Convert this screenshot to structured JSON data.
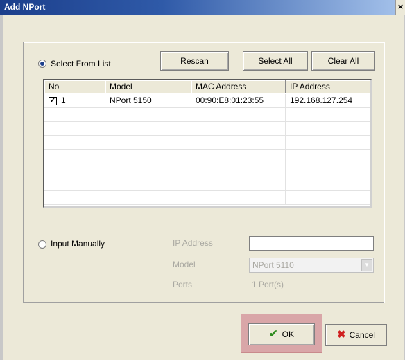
{
  "window": {
    "title": "Add NPort",
    "close_glyph": "×"
  },
  "select_from_list": {
    "label": "Select From List",
    "selected": true,
    "rescan_label": "Rescan",
    "select_all_label": "Select All",
    "clear_all_label": "Clear All"
  },
  "table": {
    "columns": [
      "No",
      "Model",
      "MAC Address",
      "IP Address"
    ],
    "rows": [
      {
        "checked": true,
        "no": "1",
        "model": "NPort 5150",
        "mac": "00:90:E8:01:23:55",
        "ip": "192.168.127.254"
      }
    ],
    "empty_rows": 7
  },
  "input_manually": {
    "label": "Input Manually",
    "selected": false,
    "ip_label": "IP Address",
    "ip_value": "",
    "model_label": "Model",
    "model_value": "NPort 5110",
    "ports_label": "Ports",
    "ports_value": "1 Port(s)"
  },
  "footer": {
    "ok_label": "OK",
    "cancel_label": "Cancel"
  },
  "colors": {
    "titlebar": "#1c3f8c",
    "highlight": "#d9a6a8",
    "ok_icon": "#2e8b1f",
    "cancel_icon": "#d02020"
  }
}
